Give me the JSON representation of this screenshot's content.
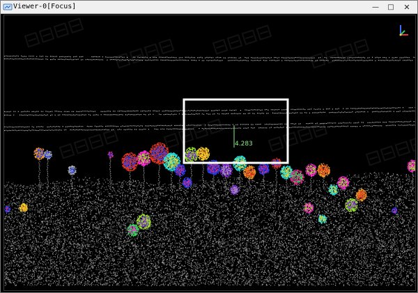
{
  "window": {
    "title": "Viewer-0[Focus]",
    "icon": "viewer-app-icon",
    "controls": {
      "minimize": "—",
      "maximize": "□",
      "close": "✕"
    }
  },
  "viewport": {
    "measurement": {
      "value": "4.283"
    },
    "selection_box_color": "#ffffff",
    "axis_icon": "xyz-axis-icon",
    "watermark_icon": "watermark-logo"
  },
  "colors": {
    "ground_points": "#8a8a8a",
    "power_lines": "#d8d8d8",
    "measure_text": "#8bf08b",
    "tree_palette": [
      "#e8361e",
      "#ff2bd4",
      "#27e3e3",
      "#2a40f5",
      "#9be82a",
      "#f5d52a",
      "#d82a8a",
      "#8a2ae8",
      "#f59a2a",
      "#2ae85a",
      "#b0b0b0"
    ]
  }
}
